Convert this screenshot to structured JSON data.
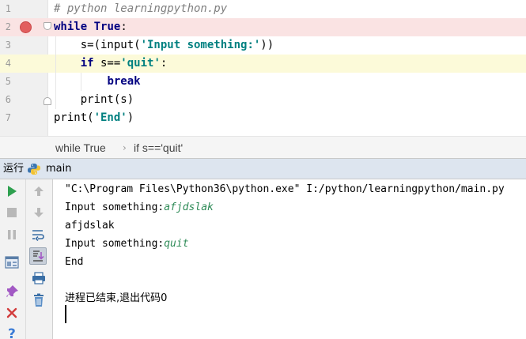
{
  "editor": {
    "lines": [
      {
        "num": "1",
        "tokens": [
          {
            "t": "# python learningpython.py",
            "c": "cmt"
          }
        ]
      },
      {
        "num": "2",
        "tokens": [
          {
            "t": "while",
            "c": "kw"
          },
          {
            "t": " ",
            "c": ""
          },
          {
            "t": "True",
            "c": "kw"
          },
          {
            "t": ":",
            "c": ""
          }
        ]
      },
      {
        "num": "3",
        "tokens": [
          {
            "t": "    s=(input(",
            "c": ""
          },
          {
            "t": "'Input something:'",
            "c": "str"
          },
          {
            "t": "))",
            "c": ""
          }
        ]
      },
      {
        "num": "4",
        "tokens": [
          {
            "t": "    ",
            "c": ""
          },
          {
            "t": "if",
            "c": "kw"
          },
          {
            "t": " s==",
            "c": ""
          },
          {
            "t": "'quit'",
            "c": "str"
          },
          {
            "t": ":",
            "c": ""
          }
        ]
      },
      {
        "num": "5",
        "tokens": [
          {
            "t": "        ",
            "c": ""
          },
          {
            "t": "break",
            "c": "kw"
          }
        ]
      },
      {
        "num": "6",
        "tokens": [
          {
            "t": "    print(s)",
            "c": ""
          }
        ]
      },
      {
        "num": "7",
        "tokens": [
          {
            "t": "print(",
            "c": ""
          },
          {
            "t": "'End'",
            "c": "str"
          },
          {
            "t": ")",
            "c": ""
          }
        ]
      }
    ]
  },
  "breadcrumb": {
    "items": [
      "while True",
      "if s=='quit'"
    ],
    "separator": "›"
  },
  "run_panel": {
    "label": "运行",
    "config_name": "main"
  },
  "toolbar": {
    "icons": [
      "rerun-icon",
      "stop-icon",
      "pause-icon",
      "layout-icon",
      "pin-icon",
      "close-icon",
      "help-icon",
      "up-arrow-icon",
      "down-arrow-icon",
      "soft-wrap-icon",
      "scroll-to-end-icon",
      "print-icon",
      "trash-icon"
    ]
  },
  "console": {
    "command": "\"C:\\Program Files\\Python36\\python.exe\" I:/python/learningpython/main.py",
    "prompt1": "Input something:",
    "input1": "afjdslak",
    "output1": "afjdslak",
    "prompt2": "Input something:",
    "input2": "quit",
    "output2": "End",
    "exit_message": "进程已结束,退出代码0"
  },
  "colors": {
    "keyword": "#000080",
    "string": "#008080",
    "comment": "#808080",
    "breakpoint": "#e25f5f",
    "breakpoint_line": "#fae3e3",
    "caret_line": "#fcfad9",
    "run_green": "#2ea04f",
    "user_input": "#2e8b57"
  }
}
